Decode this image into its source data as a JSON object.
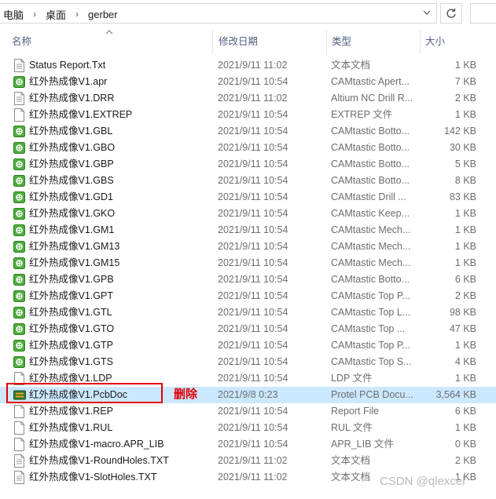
{
  "address": {
    "crumbs": [
      "电脑",
      "桌面",
      "gerber"
    ],
    "separator": "›",
    "dropdown_icon": "chevron-down-icon",
    "refresh_icon": "refresh-icon"
  },
  "columns": {
    "name": "名称",
    "date": "修改日期",
    "type": "类型",
    "size": "大小"
  },
  "files": [
    {
      "name": "Status Report.Txt",
      "date": "2021/9/11 11:02",
      "type": "文本文档",
      "size": "1 KB",
      "icon": "text-doc"
    },
    {
      "name": "红外热成像V1.apr",
      "date": "2021/9/11 10:54",
      "type": "CAMtastic Apert...",
      "size": "7 KB",
      "icon": "cam"
    },
    {
      "name": "红外热成像V1.DRR",
      "date": "2021/9/11 11:02",
      "type": "Altium NC Drill R...",
      "size": "2 KB",
      "icon": "text-doc"
    },
    {
      "name": "红外热成像V1.EXTREP",
      "date": "2021/9/11 10:54",
      "type": "EXTREP 文件",
      "size": "1 KB",
      "icon": "blank"
    },
    {
      "name": "红外热成像V1.GBL",
      "date": "2021/9/11 10:54",
      "type": "CAMtastic Botto...",
      "size": "142 KB",
      "icon": "cam"
    },
    {
      "name": "红外热成像V1.GBO",
      "date": "2021/9/11 10:54",
      "type": "CAMtastic Botto...",
      "size": "30 KB",
      "icon": "cam"
    },
    {
      "name": "红外热成像V1.GBP",
      "date": "2021/9/11 10:54",
      "type": "CAMtastic Botto...",
      "size": "5 KB",
      "icon": "cam"
    },
    {
      "name": "红外热成像V1.GBS",
      "date": "2021/9/11 10:54",
      "type": "CAMtastic Botto...",
      "size": "8 KB",
      "icon": "cam"
    },
    {
      "name": "红外热成像V1.GD1",
      "date": "2021/9/11 10:54",
      "type": "CAMtastic Drill ...",
      "size": "83 KB",
      "icon": "cam"
    },
    {
      "name": "红外热成像V1.GKO",
      "date": "2021/9/11 10:54",
      "type": "CAMtastic Keep...",
      "size": "1 KB",
      "icon": "cam"
    },
    {
      "name": "红外热成像V1.GM1",
      "date": "2021/9/11 10:54",
      "type": "CAMtastic Mech...",
      "size": "1 KB",
      "icon": "cam"
    },
    {
      "name": "红外热成像V1.GM13",
      "date": "2021/9/11 10:54",
      "type": "CAMtastic Mech...",
      "size": "1 KB",
      "icon": "cam"
    },
    {
      "name": "红外热成像V1.GM15",
      "date": "2021/9/11 10:54",
      "type": "CAMtastic Mech...",
      "size": "1 KB",
      "icon": "cam"
    },
    {
      "name": "红外热成像V1.GPB",
      "date": "2021/9/11 10:54",
      "type": "CAMtastic Botto...",
      "size": "6 KB",
      "icon": "cam"
    },
    {
      "name": "红外热成像V1.GPT",
      "date": "2021/9/11 10:54",
      "type": "CAMtastic Top P...",
      "size": "2 KB",
      "icon": "cam"
    },
    {
      "name": "红外热成像V1.GTL",
      "date": "2021/9/11 10:54",
      "type": "CAMtastic Top L...",
      "size": "98 KB",
      "icon": "cam"
    },
    {
      "name": "红外热成像V1.GTO",
      "date": "2021/9/11 10:54",
      "type": "CAMtastic Top ...",
      "size": "47 KB",
      "icon": "cam"
    },
    {
      "name": "红外热成像V1.GTP",
      "date": "2021/9/11 10:54",
      "type": "CAMtastic Top P...",
      "size": "1 KB",
      "icon": "cam"
    },
    {
      "name": "红外热成像V1.GTS",
      "date": "2021/9/11 10:54",
      "type": "CAMtastic Top S...",
      "size": "4 KB",
      "icon": "cam"
    },
    {
      "name": "红外热成像V1.LDP",
      "date": "2021/9/11 10:54",
      "type": "LDP 文件",
      "size": "1 KB",
      "icon": "blank"
    },
    {
      "name": "红外热成像V1.PcbDoc",
      "date": "2021/9/8 0:23",
      "type": "Protel PCB Docu...",
      "size": "3,564 KB",
      "icon": "pcb",
      "selected": true
    },
    {
      "name": "红外热成像V1.REP",
      "date": "2021/9/11 10:54",
      "type": "Report File",
      "size": "6 KB",
      "icon": "blank"
    },
    {
      "name": "红外热成像V1.RUL",
      "date": "2021/9/11 10:54",
      "type": "RUL 文件",
      "size": "1 KB",
      "icon": "blank"
    },
    {
      "name": "红外热成像V1-macro.APR_LIB",
      "date": "2021/9/11 10:54",
      "type": "APR_LIB 文件",
      "size": "0 KB",
      "icon": "blank"
    },
    {
      "name": "红外热成像V1-RoundHoles.TXT",
      "date": "2021/9/11 11:02",
      "type": "文本文档",
      "size": "2 KB",
      "icon": "text-doc"
    },
    {
      "name": "红外热成像V1-SlotHoles.TXT",
      "date": "2021/9/11 11:02",
      "type": "文本文档",
      "size": "1 KB",
      "icon": "text-doc"
    }
  ],
  "annotation": {
    "label": "删除",
    "color": "#e00000"
  },
  "watermark": "CSDN @qlexcel",
  "colors": {
    "selected_row": "#cce8ff",
    "cam_icon_green": "#4caf3a",
    "header_text": "#4d6082"
  }
}
